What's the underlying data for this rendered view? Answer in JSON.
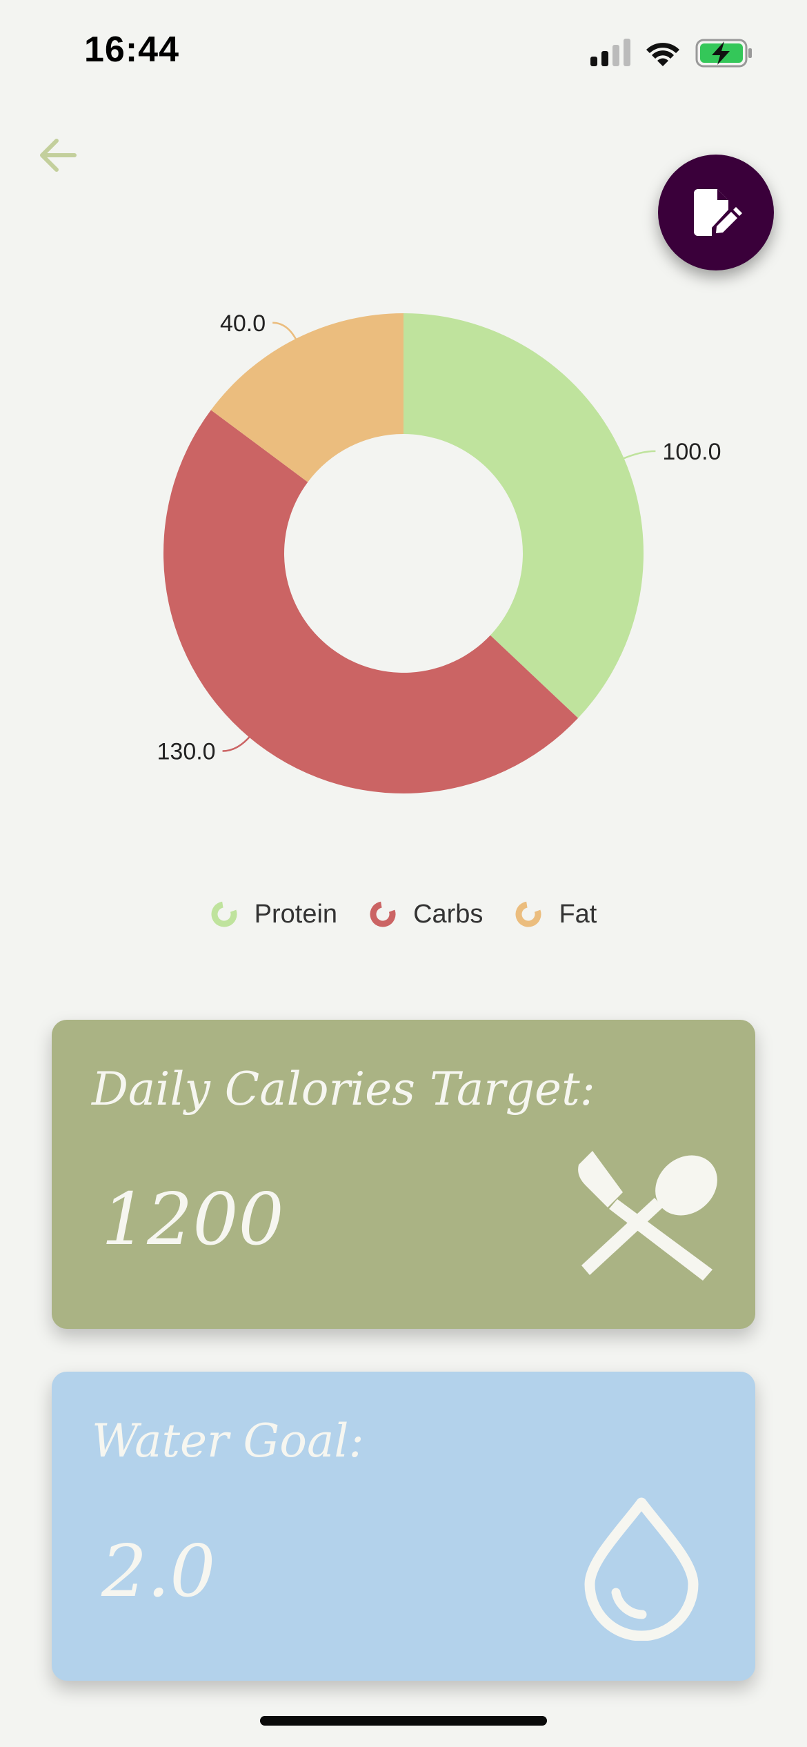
{
  "status_bar": {
    "time": "16:44"
  },
  "nav": {
    "back_icon": "arrow-left-icon",
    "edit_icon": "edit-document-icon"
  },
  "chart_data": {
    "type": "pie",
    "donut": true,
    "categories": [
      "Protein",
      "Carbs",
      "Fat"
    ],
    "values": [
      100.0,
      130.0,
      40.0
    ],
    "value_labels": [
      "100.0",
      "130.0",
      "40.0"
    ],
    "colors": [
      "#bfe39d",
      "#cb6464",
      "#ebbd7e"
    ],
    "legend_position": "bottom"
  },
  "legend": [
    {
      "label": "Protein",
      "color": "#bfe39d"
    },
    {
      "label": "Carbs",
      "color": "#cb6464"
    },
    {
      "label": "Fat",
      "color": "#ebbd7e"
    }
  ],
  "cards": {
    "calories": {
      "title": "Daily Calories Target:",
      "value": "1200",
      "icon": "fork-spoon-icon",
      "color": "#aab384"
    },
    "water": {
      "title": "Water Goal:",
      "value": "2.0",
      "icon": "water-drop-icon",
      "color": "#b3d2eb"
    }
  }
}
